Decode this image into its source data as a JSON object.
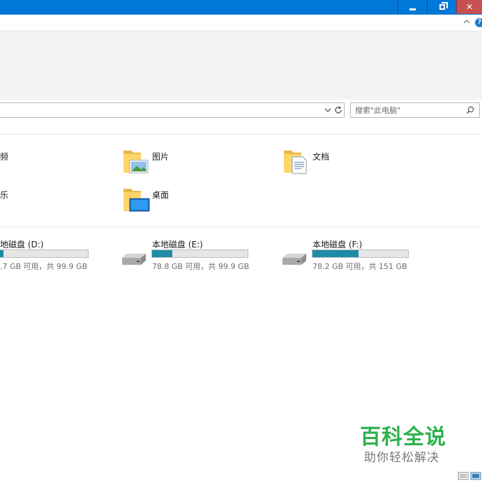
{
  "window": {
    "controls": {
      "minimize_icon": "minimize-icon",
      "restore_icon": "restore-icon",
      "close_label": "✕"
    }
  },
  "ribbon": {
    "help_label": "?"
  },
  "search": {
    "placeholder": "搜索\"此电脑\""
  },
  "folders": [
    {
      "label": "频",
      "icon": "video-folder-icon"
    },
    {
      "label": "图片",
      "icon": "pictures-folder-icon"
    },
    {
      "label": "文档",
      "icon": "documents-folder-icon"
    },
    {
      "label": "乐",
      "icon": "music-folder-icon"
    },
    {
      "label": "桌面",
      "icon": "desktop-folder-icon"
    }
  ],
  "drives": [
    {
      "name": "地磁盘 (D:)",
      "free_text": ".7 GB 可用，共 99.9 GB",
      "used_fraction": 0.12
    },
    {
      "name": "本地磁盘 (E:)",
      "free_text": "78.8 GB 可用，共 99.9 GB",
      "used_fraction": 0.21
    },
    {
      "name": "本地磁盘 (F:)",
      "free_text": "78.2 GB 可用，共 151 GB",
      "used_fraction": 0.48
    }
  ],
  "watermark": {
    "title": "百科全说",
    "subtitle": "助你轻松解决"
  },
  "colors": {
    "titlebar": "#0078d7",
    "close_button": "#c75050",
    "drive_bar": "#26a0da",
    "watermark_green": "#2bb24c"
  }
}
